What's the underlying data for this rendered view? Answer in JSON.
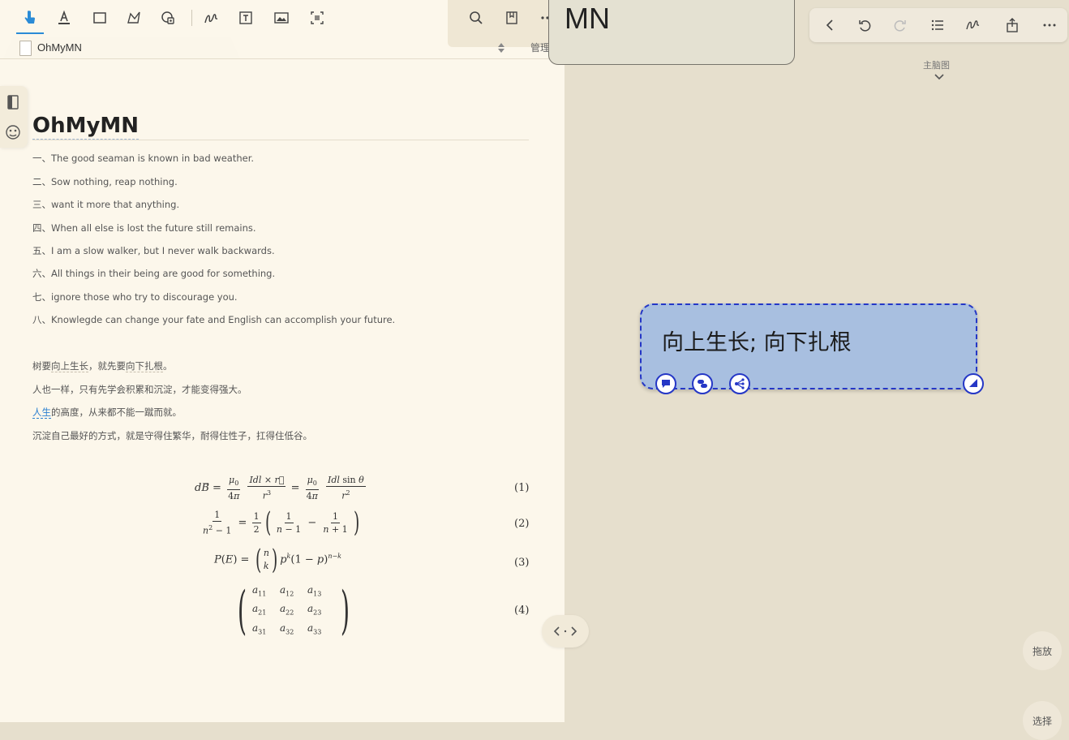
{
  "doc": {
    "tab_title": "OhMyMN",
    "manage_label": "管理",
    "title": "OhMyMN",
    "lines_en": [
      "一、The good seaman is known in bad weather.",
      "二、Sow nothing, reap nothing.",
      "三、want it more that anything.",
      "四、When all else is lost the future still remains.",
      "五、I am a slow walker, but I never walk backwards.",
      "六、All things in their being are good for something.",
      "七、ignore those who try to discourage you.",
      "八、Knowlegde can change your fate and English can accomplish your future."
    ],
    "cn_line1_a": "树要",
    "cn_line1_b": "向上生长",
    "cn_line1_c": "，就先要",
    "cn_line1_d": "向下扎根",
    "cn_line1_e": "。",
    "cn_line2": "人也一样，只有先学会积累和沉淀，才能变得强大。",
    "cn_line3_link": "人生",
    "cn_line3_rest": "的高度，从来都不能一蹴而就。",
    "cn_line4": "沉淀自己最好的方式，就是守得住繁华，耐得住性子，扛得住低谷。",
    "eq_numbers": [
      "(1)",
      "(2)",
      "(3)",
      "(4)"
    ]
  },
  "toolbar": {
    "icons": [
      "pointer-icon",
      "highlighter-icon",
      "rectangle-select-icon",
      "lasso-icon",
      "image-capture-icon",
      "pen-icon",
      "textbox-icon",
      "image-icon",
      "ocr-icon",
      "search-icon",
      "bookmark-icon",
      "more-icon"
    ]
  },
  "mindmap": {
    "top_card_text": "MN",
    "theme_label": "主脑图",
    "node_text": "向上生长; 向下扎根",
    "drag_label": "拖放",
    "select_label": "选择"
  },
  "colors": {
    "accent": "#2a8bd6",
    "node_fill": "#a8bfe0",
    "node_border": "#2537c6"
  }
}
